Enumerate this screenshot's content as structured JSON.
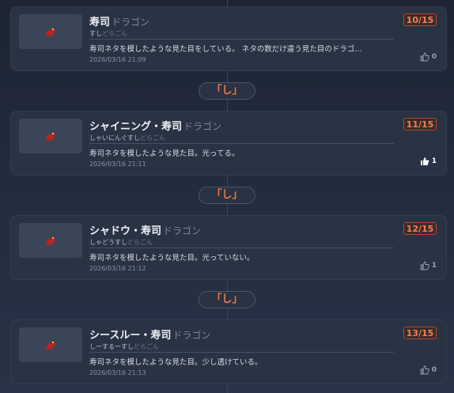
{
  "entries": [
    {
      "name": "寿司",
      "type": "ドラゴン",
      "reading": "すし",
      "reading_type": "どらごん",
      "description": "寿司ネタを模したような見た目をしている。 ネタの数だけ違う見た目のドラゴ…",
      "date": "2026/03/16 21:09",
      "badge": "10/15",
      "likes": "0",
      "liked": false
    },
    {
      "name": "シャイニング・寿司",
      "type": "ドラゴン",
      "reading": "しゃいにんぐすし",
      "reading_type": "どらごん",
      "description": "寿司ネタを模したような見た目。光ってる。",
      "date": "2026/03/16 21:11",
      "badge": "11/15",
      "likes": "1",
      "liked": true
    },
    {
      "name": "シャドウ・寿司",
      "type": "ドラゴン",
      "reading": "しゃどうすし",
      "reading_type": "どらごん",
      "description": "寿司ネタを模したような見た目。光っていない。",
      "date": "2026/03/16 21:12",
      "badge": "12/15",
      "likes": "1",
      "liked": false
    },
    {
      "name": "シースルー・寿司",
      "type": "ドラゴン",
      "reading": "しーするーすし",
      "reading_type": "どらごん",
      "description": "寿司ネタを模したような見た目。少し透けている。",
      "date": "2026/03/16 21:13",
      "badge": "13/15",
      "likes": "0",
      "liked": false
    }
  ],
  "dividers": [
    "「し」",
    "「し」",
    "「し」"
  ],
  "colors": {
    "accent": "#ee7a45",
    "badge_border": "#b5452c",
    "card_bg": "#2a3344"
  },
  "icons": {
    "thumbnail": "red-dragon-icon",
    "like": "thumbs-up-icon"
  }
}
